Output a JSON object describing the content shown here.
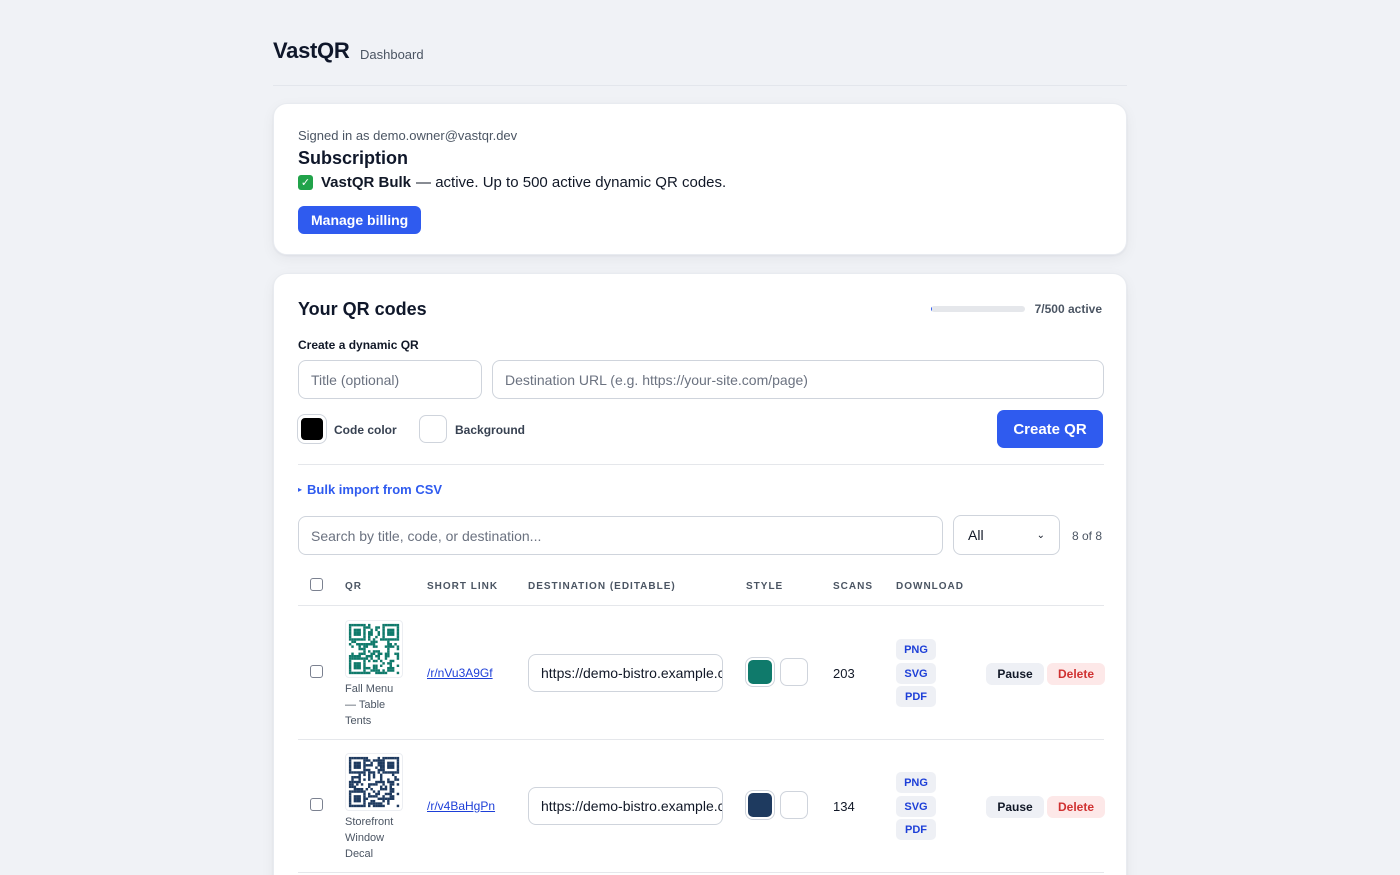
{
  "header": {
    "brand": "VastQR",
    "crumb": "Dashboard"
  },
  "subscription": {
    "signed_in": "Signed in as demo.owner@vastqr.dev",
    "title": "Subscription",
    "check_glyph": "✓",
    "plan_name": "VastQR Bulk",
    "plan_desc": "— active. Up to 500 active dynamic QR codes.",
    "billing_button": "Manage billing"
  },
  "qr": {
    "title": "Your QR codes",
    "usage_text": "7/500 active",
    "usage_fraction": 0.014,
    "create_label": "Create a dynamic QR",
    "title_placeholder": "Title (optional)",
    "url_placeholder": "Destination URL (e.g. https://your-site.com/page)",
    "code_color_label": "Code color",
    "background_label": "Background",
    "code_color": "#000000",
    "background_color": "#ffffff",
    "create_button": "Create QR",
    "bulk_arrow": "▸",
    "bulk_label": "Bulk import from CSV",
    "search_placeholder": "Search by title, code, or destination...",
    "filter_selected": "All",
    "filter_chevron": "⌄",
    "count": "8 of 8",
    "columns": {
      "qr": "QR",
      "short": "Short link",
      "dest": "Destination (editable)",
      "style": "Style",
      "scans": "Scans",
      "download": "Download"
    },
    "rows": [
      {
        "caption": "Fall Menu — Table Tents",
        "short_link": "/r/nVu3A9Gf",
        "destination": "https://demo-bistro.example.com",
        "fg": "#0f7a6b",
        "bg": "#ffffff",
        "scans": "203",
        "png": "PNG",
        "svg": "SVG",
        "pdf": "PDF",
        "pause": "Pause",
        "delete": "Delete"
      },
      {
        "caption": "Storefront Window Decal",
        "short_link": "/r/v4BaHgPn",
        "destination": "https://demo-bistro.example.com",
        "fg": "#1e3a5f",
        "bg": "#ffffff",
        "scans": "134",
        "png": "PNG",
        "svg": "SVG",
        "pdf": "PDF",
        "pause": "Pause",
        "delete": "Delete"
      }
    ]
  }
}
